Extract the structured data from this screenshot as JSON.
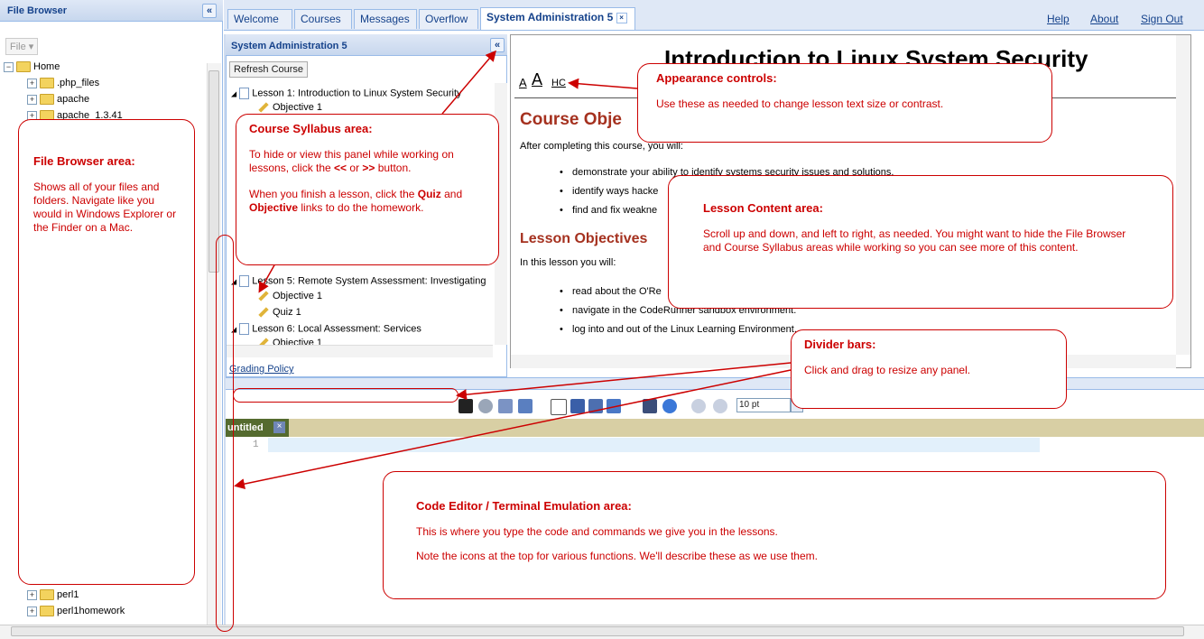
{
  "file_browser": {
    "title": "File Browser",
    "collapse": "«",
    "file_menu": "File ▾",
    "tree": [
      {
        "label": "Home"
      },
      {
        "label": ".php_files"
      },
      {
        "label": "apache"
      },
      {
        "label": "apache_1.3.41"
      },
      {
        "label": "perl1"
      },
      {
        "label": "perl1homework"
      }
    ]
  },
  "tabs": [
    {
      "label": "Welcome"
    },
    {
      "label": "Courses"
    },
    {
      "label": "Messages"
    },
    {
      "label": "Overflow"
    },
    {
      "label": "System Administration 5"
    }
  ],
  "top_links": {
    "help": "Help",
    "about": "About",
    "sign_out": "Sign Out"
  },
  "syllabus": {
    "title": "System Administration 5",
    "collapse": "«",
    "refresh": "Refresh Course",
    "items": [
      {
        "label": "Lesson 1: Introduction to Linux System Security"
      },
      {
        "label": "Objective 1"
      },
      {
        "label": "Lesson 5: Remote System Assessment: Investigating"
      },
      {
        "label": "Objective 1"
      },
      {
        "label": "Quiz 1"
      },
      {
        "label": "Lesson 6: Local Assessment: Services"
      },
      {
        "label": "Objective 1"
      }
    ],
    "grading": "Grading Policy"
  },
  "lesson": {
    "title": "Introduction to Linux System Security",
    "controls": {
      "small": "A",
      "large": "A",
      "hc": "HC"
    },
    "course_obj_heading": "Course Obje",
    "course_obj_intro": "After completing this course, you will:",
    "course_bullets": [
      "demonstrate your ability to identify systems security issues and solutions.",
      "identify ways hacke",
      "find and fix weakne"
    ],
    "lesson_obj_heading": "Lesson Objectives",
    "lesson_obj_intro": "In this lesson you will:",
    "lesson_bullets": [
      "read about the O'Re",
      "navigate in the CodeRunner sandbox environment.",
      "log into and out of the Linux Learning Environment."
    ]
  },
  "editor": {
    "font_size": "10 pt",
    "tab_label": "untitled",
    "tab_close": "×",
    "line_number": "1",
    "toolbar_icons": [
      "terminal-icon",
      "settings-icon",
      "m0-icon",
      "m1-icon",
      "new-file-icon",
      "save-icon",
      "save-as-icon",
      "open-icon",
      "find-icon",
      "preview-icon",
      "undo-icon",
      "redo-icon"
    ]
  },
  "callouts": {
    "file_browser": {
      "title": "File Browser area:",
      "body": "Shows all of your files and folders. Navigate like you would in Windows Explorer or the Finder on a Mac."
    },
    "syllabus": {
      "title": "Course Syllabus area:",
      "body1_a": "To hide or view this panel while working on lessons, click the ",
      "body1_b": "<<",
      "body1_c": " or ",
      "body1_d": ">>",
      "body1_e": " button.",
      "body2_a": "When you finish a lesson, click the ",
      "body2_b": "Quiz",
      "body2_c": " and ",
      "body2_d": "Objective",
      "body2_e": " links to do the homework."
    },
    "appearance": {
      "title": "Appearance controls:",
      "body": "Use these as needed to change lesson text size or contrast."
    },
    "lesson_content": {
      "title": "Lesson Content area:",
      "body": "Scroll up and down, and left to right, as needed. You might want to hide the File Browser and Course Syllabus areas while working so you can see more of this content."
    },
    "divider": {
      "title": "Divider bars:",
      "body": "Click and drag to resize any panel."
    },
    "code_editor": {
      "title": "Code Editor / Terminal Emulation area:",
      "body1": "This is where you type the code and commands we give you in the lessons.",
      "body2": "Note the icons at the top for various functions. We'll describe these as we use them."
    }
  },
  "colors": {
    "accent": "#15428b",
    "callout": "#cc0000",
    "heading": "#a5311f"
  }
}
